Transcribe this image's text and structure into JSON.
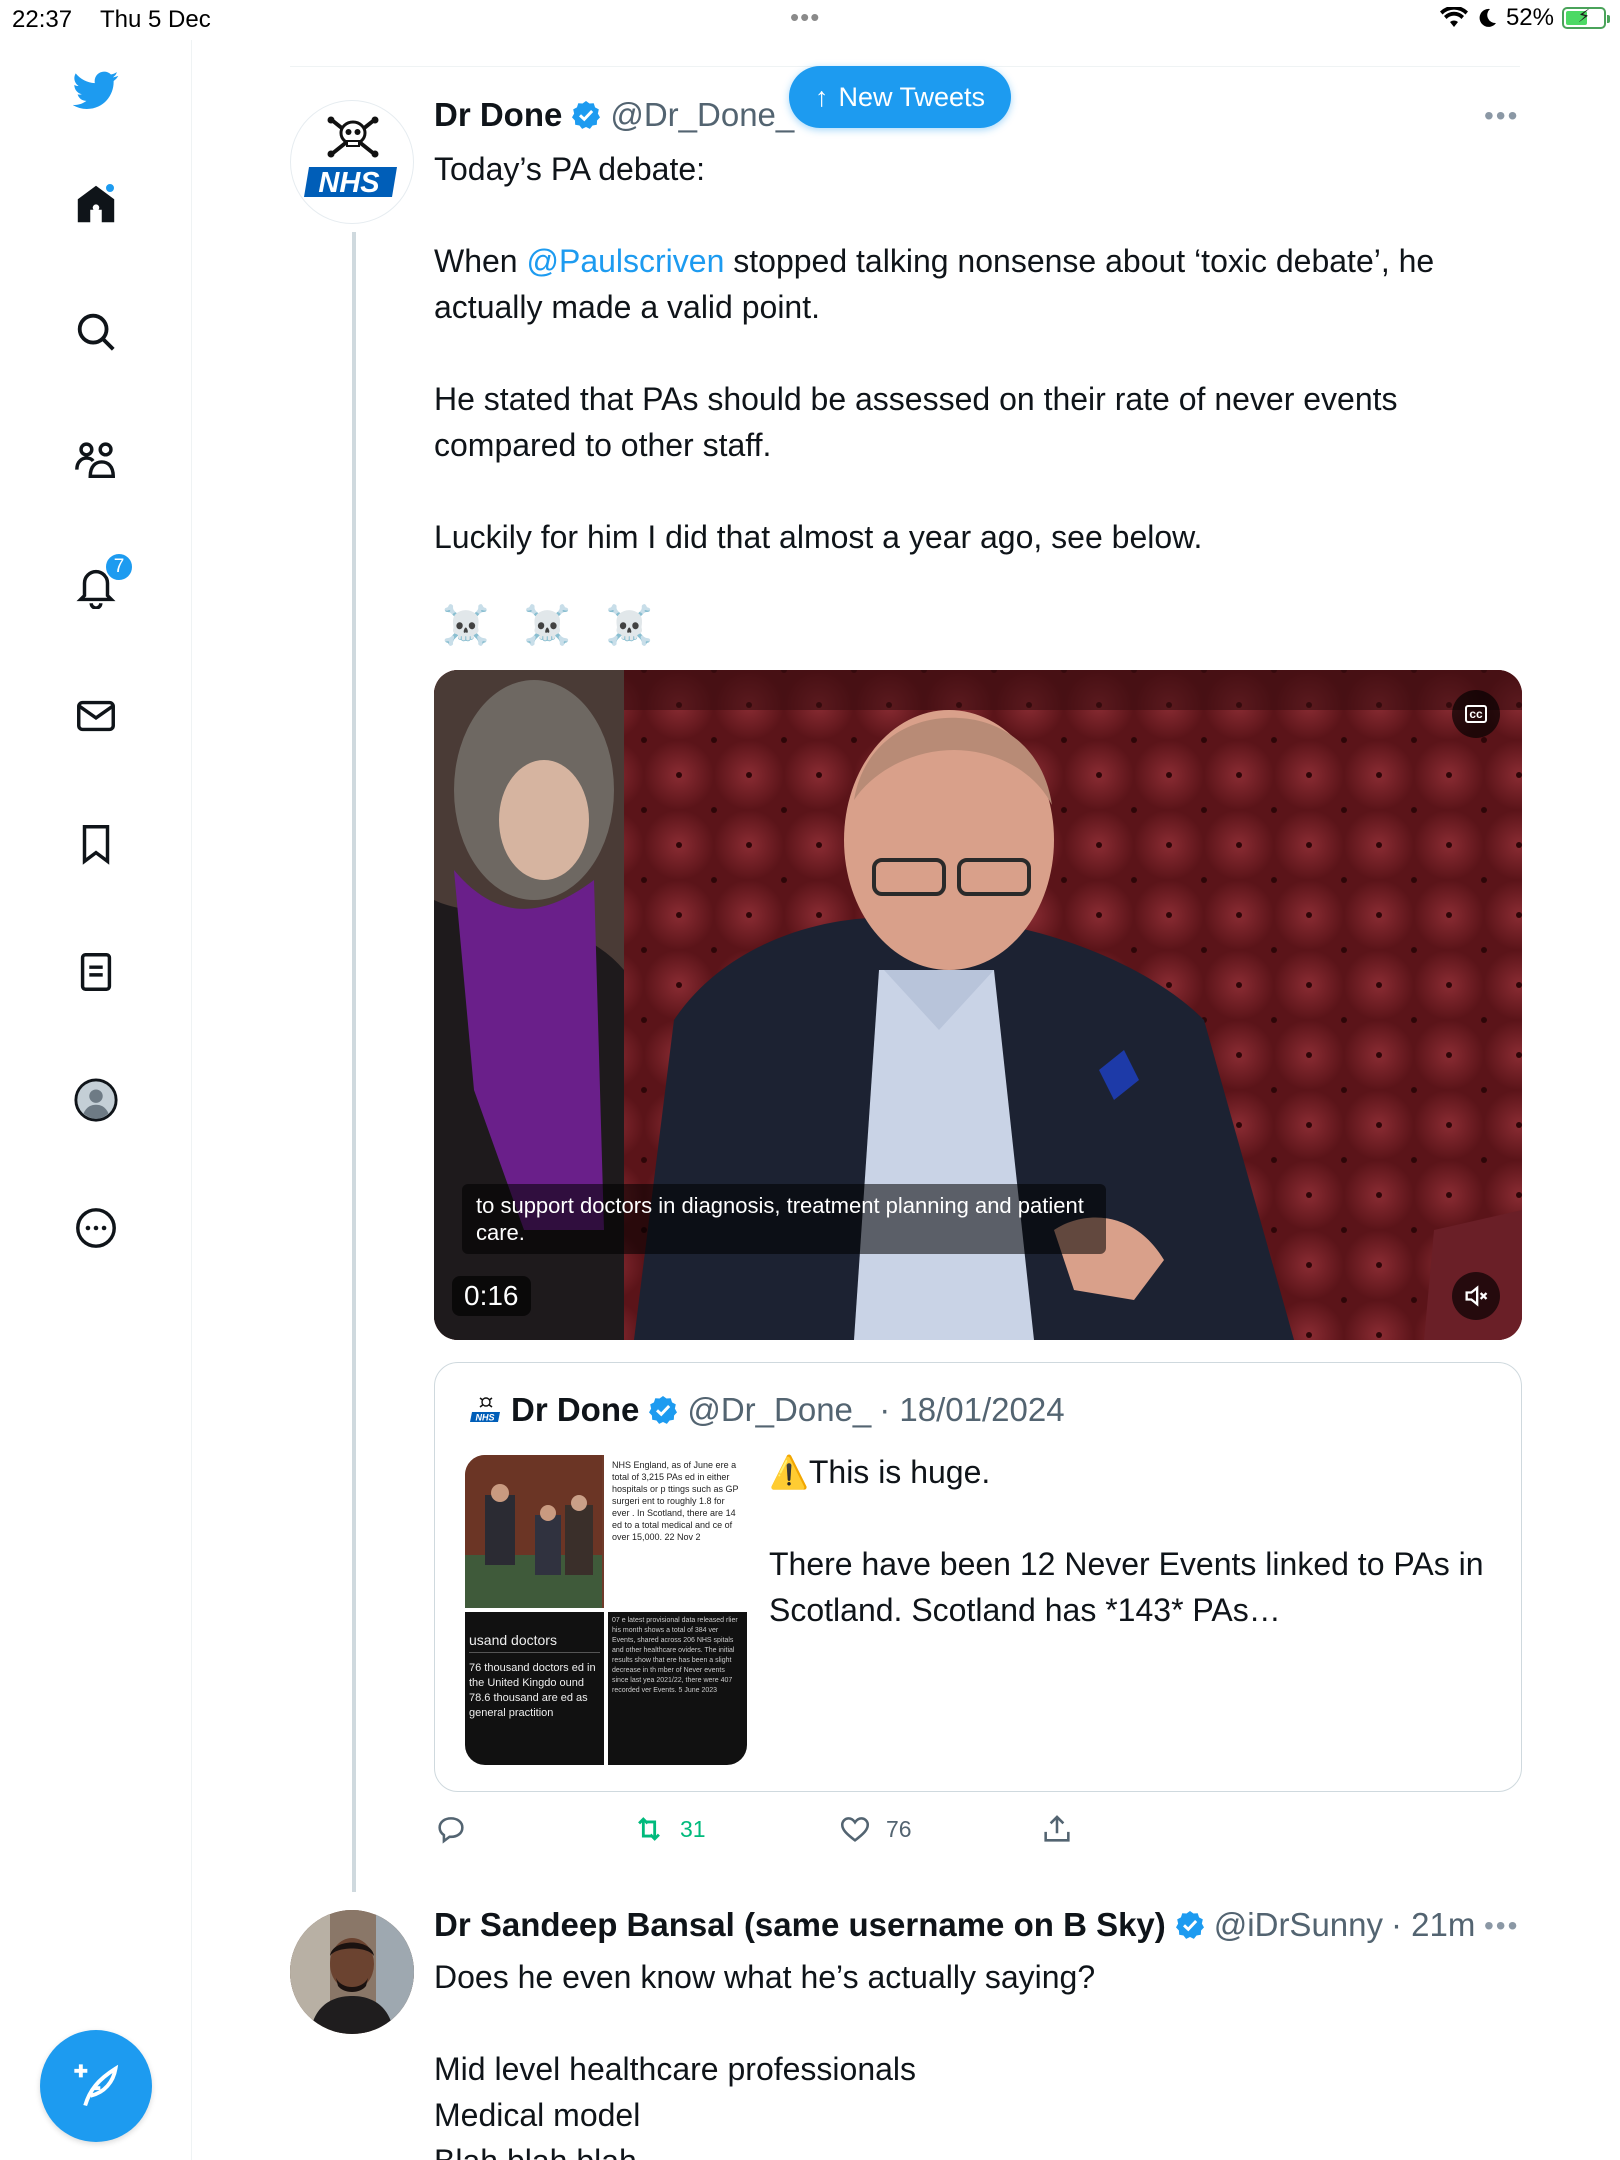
{
  "status_bar": {
    "time": "22:37",
    "date": "Thu 5 Dec",
    "battery": "52%",
    "battery_level": 0.52
  },
  "sidebar": {
    "items": [
      {
        "icon": "twitter-bird-icon",
        "label": "Twitter"
      },
      {
        "icon": "home-icon",
        "label": "Home"
      },
      {
        "icon": "search-icon",
        "label": "Explore"
      },
      {
        "icon": "communities-icon",
        "label": "Communities"
      },
      {
        "icon": "notifications-icon",
        "label": "Notifications",
        "badge": "7"
      },
      {
        "icon": "messages-icon",
        "label": "Messages"
      },
      {
        "icon": "bookmark-icon",
        "label": "Bookmarks"
      },
      {
        "icon": "lists-icon",
        "label": "Lists"
      },
      {
        "icon": "profile-icon",
        "label": "Profile"
      },
      {
        "icon": "more-icon",
        "label": "More"
      }
    ],
    "compose_icon": "compose-icon"
  },
  "new_tweets": {
    "label": "New Tweets",
    "arrow": "↑"
  },
  "tweet": {
    "name": "Dr Done",
    "handle": "@Dr_Done_",
    "handle_sep": "·",
    "text_1": "Today’s PA debate:",
    "text_2_prefix": "When ",
    "mention": "@Paulscriven",
    "text_2_suffix": " stopped talking nonsense about ‘toxic debate’, he actually made a valid point.",
    "text_3": "He stated that PAs should be assessed on their rate of never events compared to other staff.",
    "text_4": "Luckily for him I did that almost a year ago, see below.",
    "skulls": "☠️ ☠️ ☠️",
    "accent": "#1d9bf0"
  },
  "video": {
    "caption": "to support doctors in diagnosis, treatment planning and patient care.",
    "duration": "0:16",
    "cc_label": "cc"
  },
  "quote": {
    "name": "Dr Done",
    "handle": "@Dr_Done_",
    "date": "· 18/01/2024",
    "text_1": "⚠️This is huge.",
    "text_2": "There have been 12 Never Events linked to PAs in Scotland. Scotland has *143* PAs…",
    "thumb_b_text": "NHS England, as of June ere a total of 3,215 PAs ed in either hospitals or p ttings such as GP surgeri ent to roughly 1.8 for ever . In Scotland, there are 14 ed to a total medical and ce of over 15,000. 22 Nov 2",
    "thumb_c_title": "usand doctors",
    "thumb_c_text": "76 thousand doctors ed in the United Kingdo ound 78.6 thousand are ed as general practition",
    "thumb_d_text": "07 e latest provisional data released rlier his month shows a total of 384 ver Events, shared across 206 NHS spitals and other healthcare oviders. The initial results show that ere has been a slight decrease in th mber of Never events since last yea 2021/22, there were 407 recorded ver Events. 5 June 2023"
  },
  "actions": {
    "reply_count": "",
    "retweet_count": "31",
    "like_count": "76",
    "retweet_color": "#00ba7c"
  },
  "reply": {
    "name": "Dr Sandeep Bansal (same username on B Sky)",
    "handle": "@iDrSunny",
    "time": "· 21m",
    "text_1": "Does he even know what he’s actually saying?",
    "line_1": "Mid level healthcare professionals",
    "line_2": "Medical model",
    "line_3": "Blah blah blah"
  }
}
